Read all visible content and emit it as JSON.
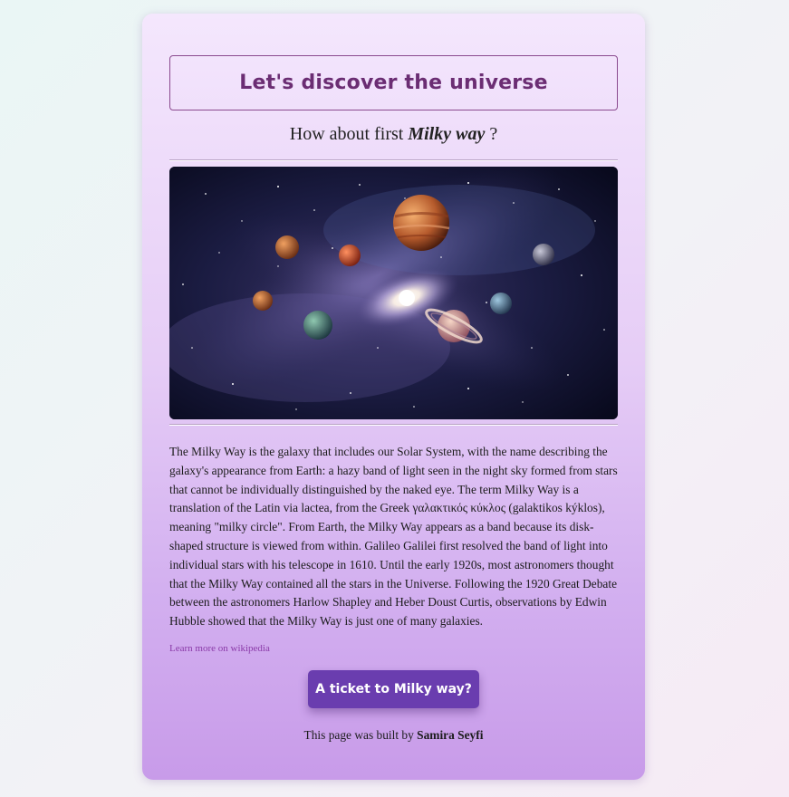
{
  "header": {
    "title": "Let's discover the universe"
  },
  "subtitle": {
    "prefix": "How about first",
    "highlight": "Milky way",
    "suffix": "?"
  },
  "image": {
    "icon": "galaxy-with-planets-image"
  },
  "article": {
    "text": "The Milky Way is the galaxy that includes our Solar System, with the name describing the galaxy's appearance from Earth: a hazy band of light seen in the night sky formed from stars that cannot be individually distinguished by the naked eye. The term Milky Way is a translation of the Latin via lactea, from the Greek γαλακτικός κύκλος (galaktikos kýklos), meaning \"milky circle\". From Earth, the Milky Way appears as a band because its disk-shaped structure is viewed from within. Galileo Galilei first resolved the band of light into individual stars with his telescope in 1610. Until the early 1920s, most astronomers thought that the Milky Way contained all the stars in the Universe. Following the 1920 Great Debate between the astronomers Harlow Shapley and Heber Doust Curtis, observations by Edwin Hubble showed that the Milky Way is just one of many galaxies."
  },
  "links": {
    "wikipedia_label": "Learn more on wikipedia"
  },
  "cta": {
    "label": "A ticket to Milky way?"
  },
  "footer": {
    "prefix": "This page was built by",
    "author": "Samira Seyfi"
  },
  "colors": {
    "accent": "#6a3daf",
    "title": "#6b2d73",
    "link": "#8a3aa8"
  }
}
